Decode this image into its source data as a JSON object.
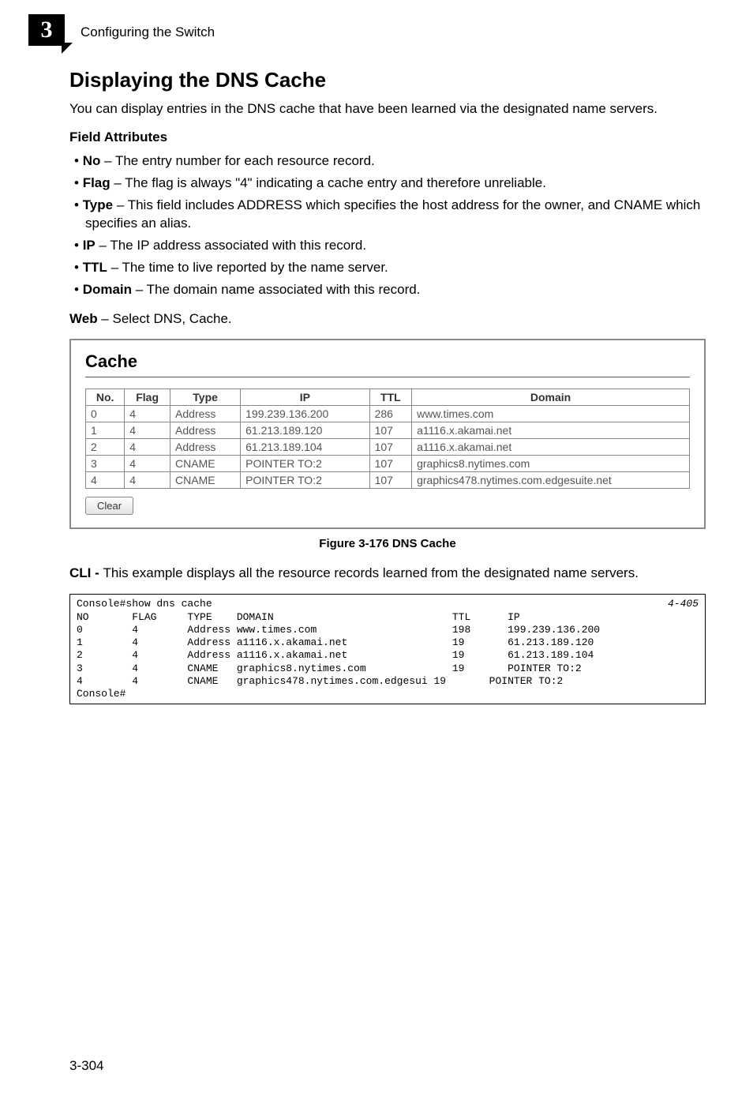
{
  "header": {
    "chapter_number": "3",
    "running_head": "Configuring the Switch"
  },
  "section": {
    "title": "Displaying the DNS Cache",
    "intro": "You can display entries in the DNS cache that have been learned via the designated name servers.",
    "field_attr_heading": "Field Attributes",
    "bullets": [
      {
        "term": "No",
        "desc": " – The entry number for each resource record."
      },
      {
        "term": "Flag",
        "desc": " – The flag is always \"4\" indicating a cache entry and therefore unreliable."
      },
      {
        "term": "Type",
        "desc": " – This field includes ADDRESS which specifies the host address for the owner, and CNAME which specifies an alias."
      },
      {
        "term": "IP",
        "desc": " – The IP address associated with this record."
      },
      {
        "term": "TTL",
        "desc": " – The time to live reported by the name server."
      },
      {
        "term": "Domain",
        "desc": " – The domain name associated with this record."
      }
    ],
    "web_line_prefix": "Web",
    "web_line_text": " – Select DNS, Cache."
  },
  "cache_screenshot": {
    "title": "Cache",
    "headers": {
      "no": "No.",
      "flag": "Flag",
      "type": "Type",
      "ip": "IP",
      "ttl": "TTL",
      "domain": "Domain"
    },
    "rows": [
      {
        "no": "0",
        "flag": "4",
        "type": "Address",
        "ip": "199.239.136.200",
        "ttl": "286",
        "domain": "www.times.com"
      },
      {
        "no": "1",
        "flag": "4",
        "type": "Address",
        "ip": "61.213.189.120",
        "ttl": "107",
        "domain": "a1116.x.akamai.net"
      },
      {
        "no": "2",
        "flag": "4",
        "type": "Address",
        "ip": "61.213.189.104",
        "ttl": "107",
        "domain": "a1116.x.akamai.net"
      },
      {
        "no": "3",
        "flag": "4",
        "type": "CNAME",
        "ip": "POINTER TO:2",
        "ttl": "107",
        "domain": "graphics8.nytimes.com"
      },
      {
        "no": "4",
        "flag": "4",
        "type": "CNAME",
        "ip": "POINTER TO:2",
        "ttl": "107",
        "domain": "graphics478.nytimes.com.edgesuite.net"
      }
    ],
    "clear_button": "Clear"
  },
  "figure_caption": "Figure 3-176  DNS Cache",
  "cli": {
    "prefix": "CLI - ",
    "text": "This example displays all the resource records learned from the designated name servers.",
    "ref": "4-405",
    "lines": [
      "Console#show dns cache",
      "NO       FLAG     TYPE    DOMAIN                             TTL      IP",
      "0        4        Address www.times.com                      198      199.239.136.200",
      "1        4        Address a1116.x.akamai.net                 19       61.213.189.120",
      "2        4        Address a1116.x.akamai.net                 19       61.213.189.104",
      "3        4        CNAME   graphics8.nytimes.com              19       POINTER TO:2",
      "4        4        CNAME   graphics478.nytimes.com.edgesui 19       POINTER TO:2",
      "Console#"
    ]
  },
  "page_number": "3-304"
}
